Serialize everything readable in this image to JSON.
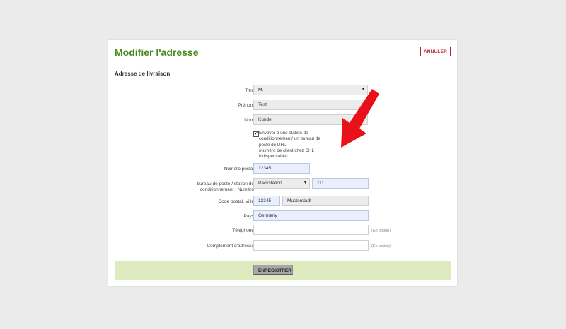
{
  "header": {
    "title": "Modifier l'adresse",
    "cancel_label": "ANNULER"
  },
  "section_title": "Adresse de livraison",
  "fields": {
    "titre": {
      "label": "Titre",
      "value": "M."
    },
    "prenom": {
      "label": "Prénom",
      "value": "Test"
    },
    "nom": {
      "label": "Nom",
      "value": "Kunde"
    },
    "numero_postal": {
      "label": "Numéro postal",
      "value": "12345"
    },
    "bureau": {
      "label_line1": "bureau de poste / station de",
      "label_line2": "conditionnement , Numéro",
      "select_value": "Packstation",
      "number_value": "111"
    },
    "code_postal": {
      "label": "Code postal, Ville",
      "zip": "12345",
      "city": "Musterstadt"
    },
    "pays": {
      "label": "Pays",
      "value": "Germany"
    },
    "telephone": {
      "label": "Téléphone",
      "value": "",
      "optional": "(En option)"
    },
    "complement": {
      "label": "Complément d'adresse",
      "value": "",
      "optional": "(En option)"
    }
  },
  "checkbox": {
    "checked": true,
    "line1": "Envoyer à une station de",
    "line2": "conditionnement/ un bureau de",
    "line3": "poste de DHL",
    "line4": "(numéro de client chez DHL",
    "line5": "indispensable)"
  },
  "footer": {
    "save_label": "ENREGISTRER"
  },
  "colors": {
    "accent": "#4a8a1c",
    "cancel": "#c0202a",
    "footer_bg": "#dfebbf",
    "arrow": "#e8111a"
  }
}
